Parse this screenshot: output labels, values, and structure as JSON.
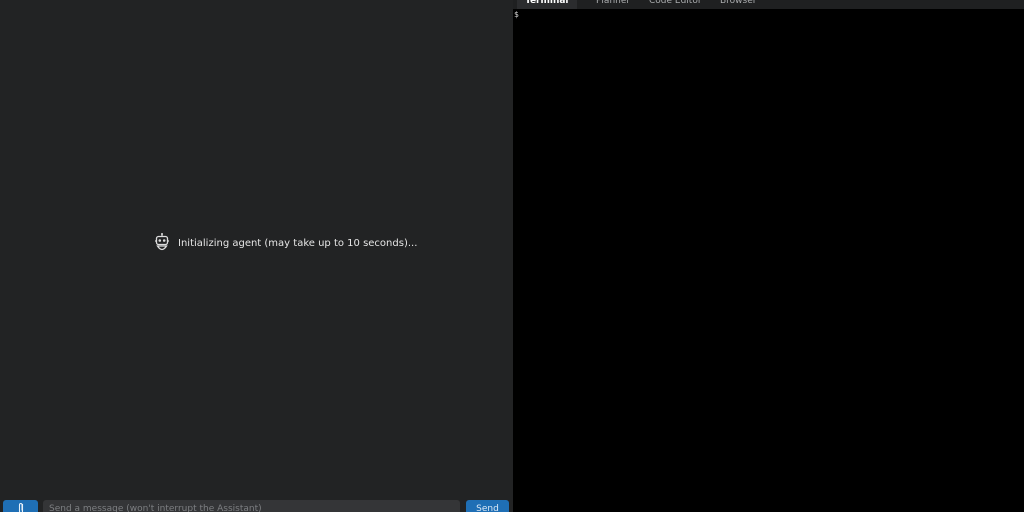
{
  "chat": {
    "status_text": "Initializing agent (may take up to 10 seconds)...",
    "input_placeholder": "Send a message (won't interrupt the Assistant)",
    "send_label": "Send",
    "attach_icon": "paperclip-icon",
    "status_icon": "robot-icon"
  },
  "tabs": [
    {
      "label": "Terminal",
      "active": true
    },
    {
      "label": "Planner",
      "active": false
    },
    {
      "label": "Code Editor",
      "active": false
    },
    {
      "label": "Browser",
      "active": false
    }
  ],
  "terminal": {
    "prompt": "$"
  },
  "colors": {
    "chat_background": "#222324",
    "terminal_background": "#000000",
    "accent_button": "#1f6fb5",
    "input_background": "#343537"
  }
}
